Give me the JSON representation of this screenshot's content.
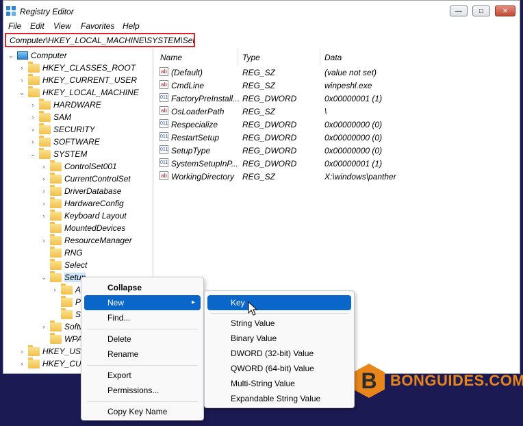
{
  "window": {
    "title": "Registry Editor",
    "menu": [
      "File",
      "Edit",
      "View",
      "Favorites",
      "Help"
    ],
    "address": "Computer\\HKEY_LOCAL_MACHINE\\SYSTEM\\Setup"
  },
  "tree": {
    "computer": "Computer",
    "hkcr": "HKEY_CLASSES_ROOT",
    "hkcu": "HKEY_CURRENT_USER",
    "hklm": "HKEY_LOCAL_MACHINE",
    "hardware": "HARDWARE",
    "sam": "SAM",
    "security": "SECURITY",
    "software": "SOFTWARE",
    "system": "SYSTEM",
    "controlset": "ControlSet001",
    "currentcontrolset": "CurrentControlSet",
    "driverdatabase": "DriverDatabase",
    "hardwareconfig": "HardwareConfig",
    "keyboardlayout": "Keyboard Layout",
    "mounteddevices": "MountedDevices",
    "resourcemanager": "ResourceManager",
    "rng": "RNG",
    "select": "Select",
    "setup": "Setup",
    "setup_child1": "A",
    "setup_child2": "P",
    "setup_child3": "S",
    "software2": "Softw",
    "wpa": "WPA",
    "hku": "HKEY_USE",
    "hkcc": "HKEY_CUR"
  },
  "columns": {
    "name": "Name",
    "type": "Type",
    "data": "Data"
  },
  "values": [
    {
      "kind": "sz",
      "name": "(Default)",
      "type": "REG_SZ",
      "data": "(value not set)"
    },
    {
      "kind": "sz",
      "name": "CmdLine",
      "type": "REG_SZ",
      "data": "winpeshl.exe"
    },
    {
      "kind": "dword",
      "name": "FactoryPreInstall...",
      "type": "REG_DWORD",
      "data": "0x00000001 (1)"
    },
    {
      "kind": "sz",
      "name": "OsLoaderPath",
      "type": "REG_SZ",
      "data": "\\"
    },
    {
      "kind": "dword",
      "name": "Respecialize",
      "type": "REG_DWORD",
      "data": "0x00000000 (0)"
    },
    {
      "kind": "dword",
      "name": "RestartSetup",
      "type": "REG_DWORD",
      "data": "0x00000000 (0)"
    },
    {
      "kind": "dword",
      "name": "SetupType",
      "type": "REG_DWORD",
      "data": "0x00000000 (0)"
    },
    {
      "kind": "dword",
      "name": "SystemSetupInP...",
      "type": "REG_DWORD",
      "data": "0x00000001 (1)"
    },
    {
      "kind": "sz",
      "name": "WorkingDirectory",
      "type": "REG_SZ",
      "data": "X:\\windows\\panther"
    }
  ],
  "context_menu": {
    "collapse": "Collapse",
    "new": "New",
    "find": "Find...",
    "delete": "Delete",
    "rename": "Rename",
    "export": "Export",
    "permissions": "Permissions...",
    "copy_key_name": "Copy Key Name"
  },
  "submenu": {
    "key": "Key",
    "string": "String Value",
    "binary": "Binary Value",
    "dword": "DWORD (32-bit) Value",
    "qword": "QWORD (64-bit) Value",
    "multi": "Multi-String Value",
    "expandable": "Expandable String Value"
  },
  "watermark": {
    "letter": "B",
    "text": "BONGUIDES.COM"
  }
}
